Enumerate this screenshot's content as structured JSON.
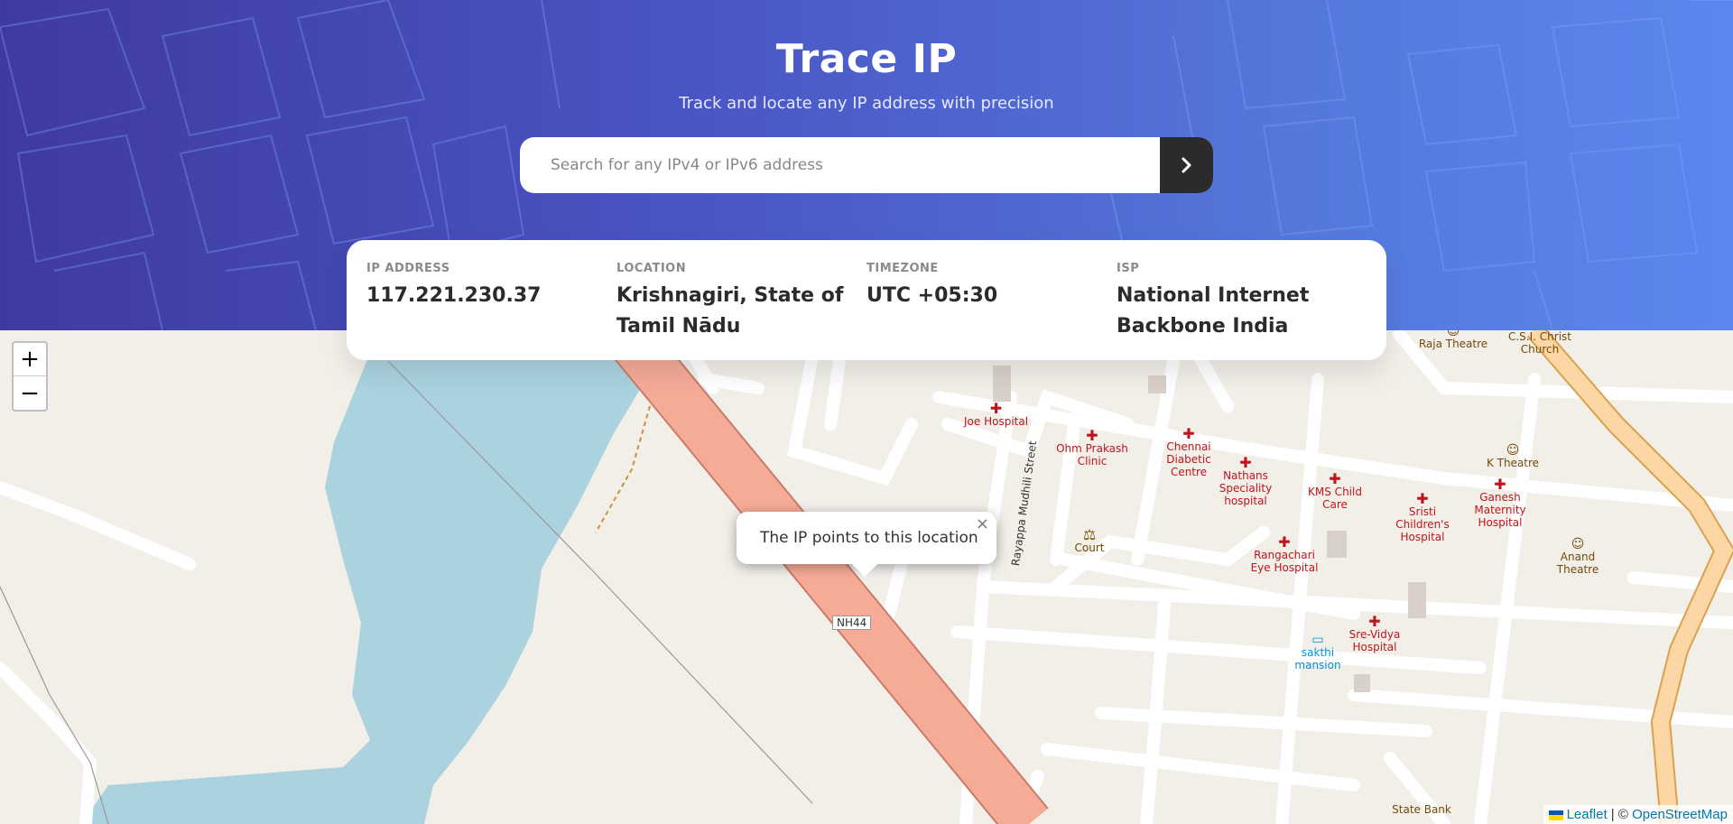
{
  "header": {
    "title": "Trace IP",
    "subtitle": "Track and locate any IP address with precision"
  },
  "search": {
    "placeholder": "Search for any IPv4 or IPv6 address",
    "value": "",
    "button_icon": "chevron-right-icon"
  },
  "info": {
    "ip_label": "IP ADDRESS",
    "ip_value": "117.221.230.37",
    "location_label": "LOCATION",
    "location_value": "Krishnagiri, State of Tamil Nādu",
    "timezone_label": "TIMEZONE",
    "timezone_value": "UTC +05:30",
    "isp_label": "ISP",
    "isp_value": "National Internet Backbone India"
  },
  "map": {
    "zoom_in": "+",
    "zoom_out": "−",
    "popup_text": "The IP points to this location",
    "popup_close": "×",
    "attribution_leaflet": "Leaflet",
    "attribution_sep": " | © ",
    "attribution_osm": "OpenStreetMap",
    "labels": {
      "joe_hospital": "Joe Hospital",
      "ohm_prakash": "Ohm Prakash Clinic",
      "chennai_diabetic": "Chennai Diabetic Centre",
      "nathans": "Nathans Speciality hospital",
      "kms_child": "KMS Child Care",
      "sristi": "Sristi Children's Hospital",
      "ganesh": "Ganesh Maternity Hospital",
      "k_theatre": "K Theatre",
      "raja_theatre": "Raja Theatre",
      "csi_church": "C.S.I. Christ Church",
      "court": "Court",
      "rangachari": "Rangachari Eye Hospital",
      "sre_vidya": "Sre-Vidya Hospital",
      "sakthi": "sakthi mansion",
      "anand_theatre": "Anand Theatre",
      "state_bank": "State Bank",
      "rayappa": "Rayappa Mudhili Street",
      "nh44": "NH44"
    }
  },
  "colors": {
    "header_start": "#3f3aa0",
    "header_end": "#5c86ee",
    "water": "#aad3df",
    "highway": "#f6ab97",
    "primary_road": "#fcd6a4",
    "land": "#f2efe9",
    "poi_red": "#c0141d"
  }
}
